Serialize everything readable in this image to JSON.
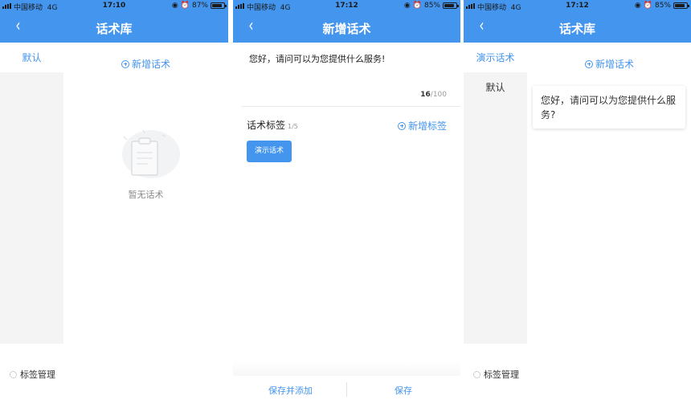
{
  "screens": [
    {
      "status": {
        "carrier": "中国移动",
        "network": "4G",
        "time": "17:10",
        "battery": "87%"
      },
      "nav": {
        "back": "‹",
        "title": "话术库"
      },
      "sidebar": {
        "active_item": "默认"
      },
      "add_speech_label": "新增话术",
      "empty_text": "暂无话术",
      "tag_manage_label": "标签管理"
    },
    {
      "status": {
        "carrier": "中国移动",
        "network": "4G",
        "time": "17:12",
        "battery": "85%"
      },
      "nav": {
        "back": "‹",
        "title": "新增话术"
      },
      "content_value": "您好，请问可以为您提供什么服务!",
      "char_count": {
        "current": "16",
        "max": "/100"
      },
      "tags_section": {
        "title": "话术标签",
        "count": "1/5",
        "add_label": "新增标签"
      },
      "selected_tag": "演示话术",
      "footer": {
        "save_and_add": "保存并添加",
        "save": "保存"
      }
    },
    {
      "status": {
        "carrier": "中国移动",
        "network": "4G",
        "time": "17:12",
        "battery": "85%"
      },
      "nav": {
        "back": "‹",
        "title": "话术库"
      },
      "sidebar": {
        "active_item": "演示话术",
        "items": [
          "默认"
        ]
      },
      "add_speech_label": "新增话术",
      "speech_card_text": "您好，请问可以为您提供什么服务?",
      "tag_manage_label": "标签管理"
    }
  ],
  "battery_fill": [
    0.87,
    0.85,
    0.85
  ],
  "colors": {
    "accent": "#4495ee",
    "sidebar_bg": "#f4f4f4"
  },
  "icons": [
    "back-chevron-icon",
    "plus-circle-icon",
    "gear-icon",
    "clipboard-icon",
    "alarm-icon",
    "lock-rotation-icon"
  ]
}
